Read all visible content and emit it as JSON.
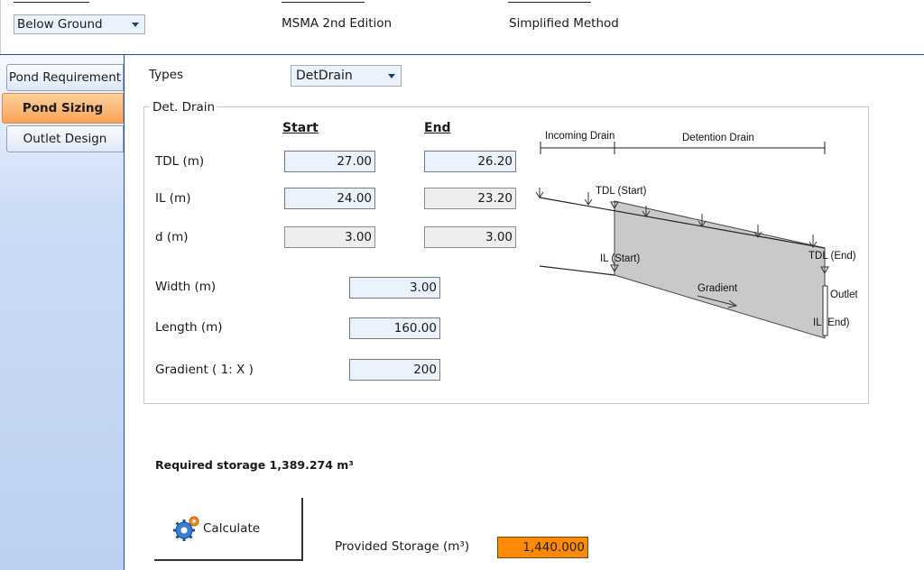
{
  "top_bar": {
    "storage_type": "Below Ground",
    "standard": "MSMA 2nd Edition",
    "method": "Simplified Method"
  },
  "sidebar": {
    "tabs": [
      {
        "label": "Pond Requirement",
        "active": false
      },
      {
        "label": "Pond Sizing",
        "active": true
      },
      {
        "label": "Outlet Design",
        "active": false
      }
    ]
  },
  "types": {
    "label": "Types",
    "value": "DetDrain"
  },
  "det_drain": {
    "group_title": "Det. Drain",
    "col_start": "Start",
    "col_end": "End",
    "tdl": {
      "label": "TDL (m)",
      "start": "27.00",
      "end": "26.20"
    },
    "il": {
      "label": "IL (m)",
      "start": "24.00",
      "end": "23.20"
    },
    "d": {
      "label": "d (m)",
      "start": "3.00",
      "end": "3.00"
    },
    "width": {
      "label": "Width (m)",
      "value": "3.00"
    },
    "length": {
      "label": "Length (m)",
      "value": "160.00"
    },
    "gradient": {
      "label": "Gradient ( 1: X )",
      "value": "200"
    }
  },
  "diagram": {
    "incoming_drain": "Incoming Drain",
    "detention_drain": "Detention Drain",
    "tdl_start": "TDL (Start)",
    "il_start": "IL (Start)",
    "tdl_end": "TDL (End)",
    "il_end": "IL (End)",
    "gradient": "Gradient",
    "outlet": "Outlet"
  },
  "required_storage": "Required storage 1,389.274 m³",
  "calculate_label": "Calculate",
  "provided_storage": {
    "label": "Provided Storage (m³)",
    "value": "1,440.000"
  },
  "colors": {
    "accent_blue": "#1f4bb5",
    "active_tab": "#f9a45a",
    "provided_highlight": "#ff8a05",
    "input_bg": "#eaf2fd"
  }
}
